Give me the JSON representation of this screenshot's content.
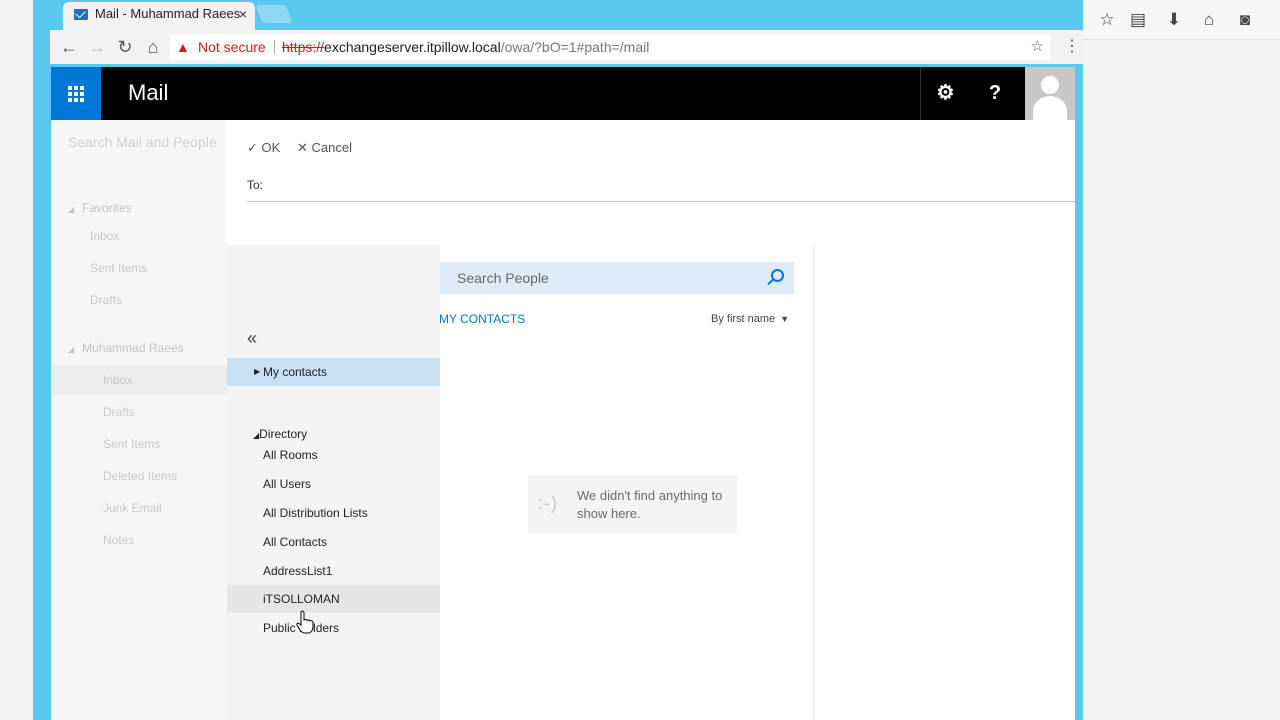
{
  "browser": {
    "tab_title": "Mail - Muhammad Raees",
    "tab_close": "×",
    "security_text": "Not secure",
    "url_scheme": "https://",
    "url_host": "exchangeserver.itpillow.local",
    "url_path": "/owa/?bO=1#path=/mail"
  },
  "header": {
    "app_title": "Mail",
    "settings_glyph": "⚙",
    "help_glyph": "?"
  },
  "folder_pane": {
    "search_placeholder": "Search Mail and People",
    "favorites_label": "Favorites",
    "favorites": [
      "Inbox",
      "Sent Items",
      "Drafts"
    ],
    "account_label": "Muhammad Raees",
    "account_folders": [
      "Inbox",
      "Drafts",
      "Sent Items",
      "Deleted Items",
      "Junk Email",
      "Notes"
    ]
  },
  "compose": {
    "ok_label": "OK",
    "cancel_label": "Cancel",
    "to_label": "To:"
  },
  "people_picker": {
    "collapse_glyph": "«",
    "my_contacts": "My contacts",
    "directory": "Directory",
    "directory_items": [
      "All Rooms",
      "All Users",
      "All Distribution Lists",
      "All Contacts",
      "AddressList1",
      "iTSOLLOMAN",
      "Public Folders"
    ],
    "search_placeholder": "Search People",
    "tab_label": "MY CONTACTS",
    "sort_label": "By first name",
    "empty_face": ":-)",
    "empty_message": "We didn't find anything to show here."
  },
  "colors": {
    "accent": "#0078d7",
    "chrome_frame": "#5bc8ee",
    "selected_row": "#c7e0f4",
    "search_bg": "#deecf9"
  }
}
